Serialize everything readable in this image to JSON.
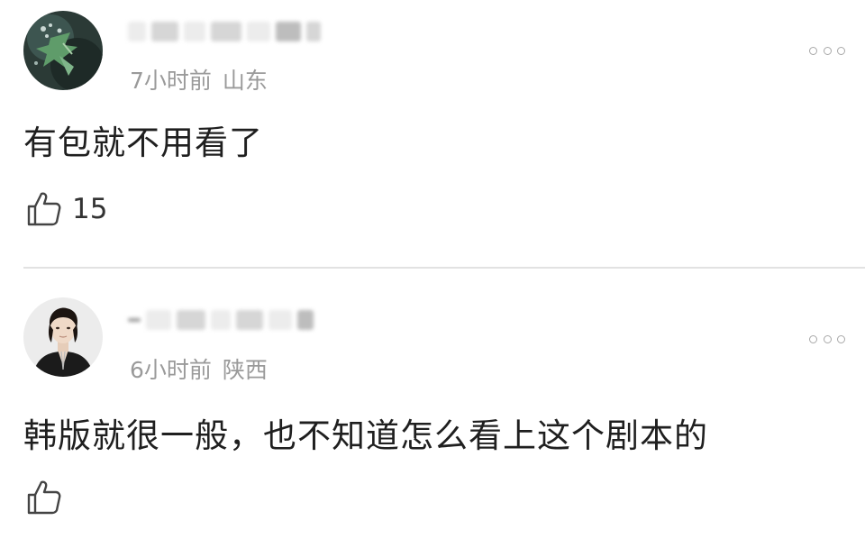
{
  "comments": [
    {
      "time": "7小时前",
      "location": "山东",
      "text": "有包就不用看了",
      "likes": "15",
      "more_icon": "more-dots-icon",
      "like_icon": "thumbs-up-icon"
    },
    {
      "time": "6小时前",
      "location": "陕西",
      "text": "韩版就很一般，也不知道怎么看上这个剧本的",
      "likes": "",
      "more_icon": "more-dots-icon",
      "like_icon": "thumbs-up-icon"
    }
  ],
  "colors": {
    "meta_text": "#9a9a9a",
    "body_text": "#1f1f1f",
    "divider": "#e2e2e2",
    "icon_gray": "#a8a8a8"
  }
}
